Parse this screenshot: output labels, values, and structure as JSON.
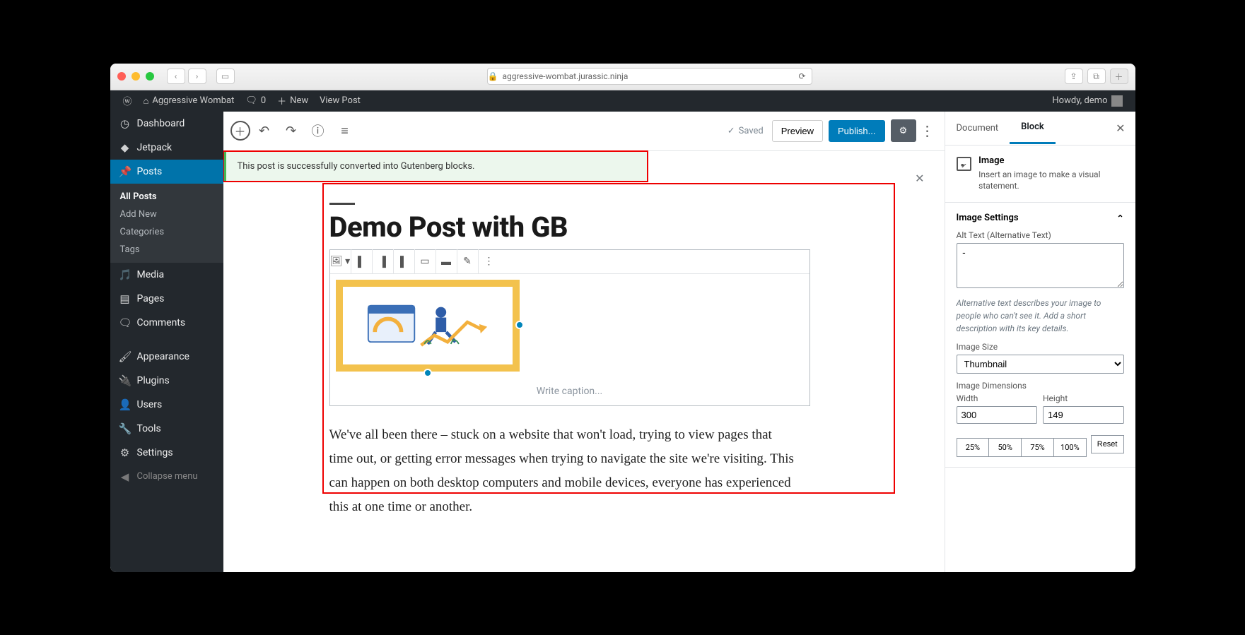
{
  "browser": {
    "url_host": "aggressive-wombat.jurassic.ninja"
  },
  "wpbar": {
    "site_name": "Aggressive Wombat",
    "comments_count": "0",
    "new_label": "New",
    "view_post": "View Post",
    "howdy": "Howdy, demo"
  },
  "sidebar": {
    "dashboard": "Dashboard",
    "jetpack": "Jetpack",
    "posts": "Posts",
    "posts_sub": {
      "all": "All Posts",
      "add": "Add New",
      "cats": "Categories",
      "tags": "Tags"
    },
    "media": "Media",
    "pages": "Pages",
    "comments": "Comments",
    "appearance": "Appearance",
    "plugins": "Plugins",
    "users": "Users",
    "tools": "Tools",
    "settings": "Settings",
    "collapse": "Collapse menu"
  },
  "editor": {
    "saved": "Saved",
    "preview": "Preview",
    "publish": "Publish...",
    "notice": "This post is successfully converted into Gutenberg blocks.",
    "title": "Demo Post with GB",
    "caption_placeholder": "Write caption...",
    "paragraph": "We've all been there – stuck on a website that won't load, trying to view pages that time out, or getting error messages when trying to navigate the site we're visiting. This can happen on both desktop computers and mobile devices, everyone has experienced this at one time or another."
  },
  "panel": {
    "tab_document": "Document",
    "tab_block": "Block",
    "block_name": "Image",
    "block_desc": "Insert an image to make a visual statement.",
    "section_title": "Image Settings",
    "alt_label": "Alt Text (Alternative Text)",
    "alt_value": "-",
    "alt_help": "Alternative text describes your image to people who can't see it. Add a short description with its key details.",
    "size_label": "Image Size",
    "size_value": "Thumbnail",
    "dims_label": "Image Dimensions",
    "width_label": "Width",
    "width_value": "300",
    "height_label": "Height",
    "height_value": "149",
    "pct25": "25%",
    "pct50": "50%",
    "pct75": "75%",
    "pct100": "100%",
    "reset": "Reset"
  }
}
